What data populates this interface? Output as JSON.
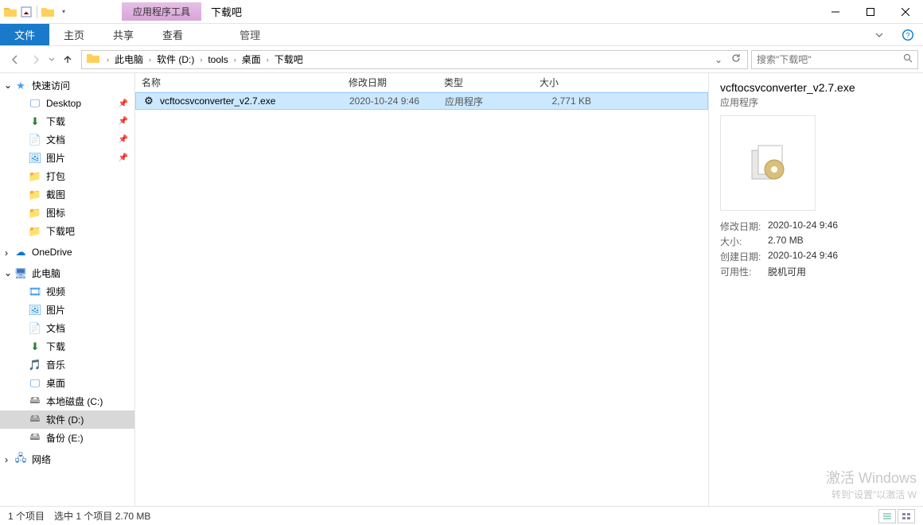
{
  "titlebar": {
    "tools_tab": "应用程序工具",
    "window_title": "下载吧"
  },
  "ribbon": {
    "file": "文件",
    "tabs": [
      "主页",
      "共享",
      "查看"
    ],
    "manage": "管理"
  },
  "breadcrumb": [
    "此电脑",
    "软件 (D:)",
    "tools",
    "桌面",
    "下载吧"
  ],
  "search": {
    "placeholder": "搜索\"下载吧\""
  },
  "sidebar": {
    "quick": {
      "label": "快速访问",
      "items": [
        {
          "label": "Desktop",
          "pin": true
        },
        {
          "label": "下载",
          "pin": true
        },
        {
          "label": "文档",
          "pin": true
        },
        {
          "label": "图片",
          "pin": true
        },
        {
          "label": "打包"
        },
        {
          "label": "截图"
        },
        {
          "label": "图标"
        },
        {
          "label": "下载吧"
        }
      ]
    },
    "onedrive": "OneDrive",
    "thispc": {
      "label": "此电脑",
      "items": [
        {
          "label": "视频"
        },
        {
          "label": "图片"
        },
        {
          "label": "文档"
        },
        {
          "label": "下载"
        },
        {
          "label": "音乐"
        },
        {
          "label": "桌面"
        },
        {
          "label": "本地磁盘 (C:)"
        },
        {
          "label": "软件 (D:)",
          "selected": true
        },
        {
          "label": "备份 (E:)"
        }
      ]
    },
    "network": "网络"
  },
  "columns": {
    "name": "名称",
    "date": "修改日期",
    "type": "类型",
    "size": "大小"
  },
  "rows": [
    {
      "name": "vcftocsvconverter_v2.7.exe",
      "date": "2020-10-24 9:46",
      "type": "应用程序",
      "size": "2,771 KB",
      "selected": true
    }
  ],
  "preview": {
    "title": "vcftocsvconverter_v2.7.exe",
    "type": "应用程序",
    "meta": [
      {
        "k": "修改日期:",
        "v": "2020-10-24 9:46"
      },
      {
        "k": "大小:",
        "v": "2.70 MB"
      },
      {
        "k": "创建日期:",
        "v": "2020-10-24 9:46"
      },
      {
        "k": "可用性:",
        "v": "脱机可用"
      }
    ]
  },
  "status": {
    "count": "1 个项目",
    "selection": "选中 1 个项目  2.70 MB"
  },
  "watermark": {
    "l1": "激活 Windows",
    "l2": "转到\"设置\"以激活 W"
  }
}
